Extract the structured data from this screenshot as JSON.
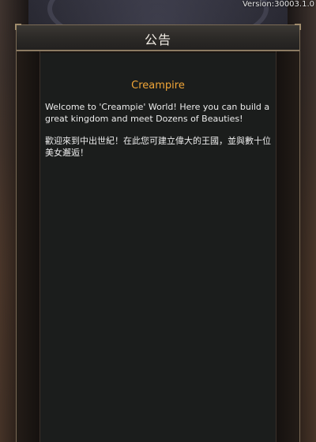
{
  "version_label": "Version:30003.1.0",
  "notice": {
    "title": "公告",
    "heading": "Creampire",
    "english_text": "Welcome to 'Creampie' World! Here you can build a great kingdom and meet Dozens of Beauties!",
    "chinese_text": "歡迎來到中出世紀！在此您可建立偉大的王國，並與數十位美女邂逅！"
  },
  "colors": {
    "heading": "#f0a537",
    "body_text": "#ececec",
    "panel_bg": "#1b1d1c",
    "header_bg": "#2c2a27"
  }
}
